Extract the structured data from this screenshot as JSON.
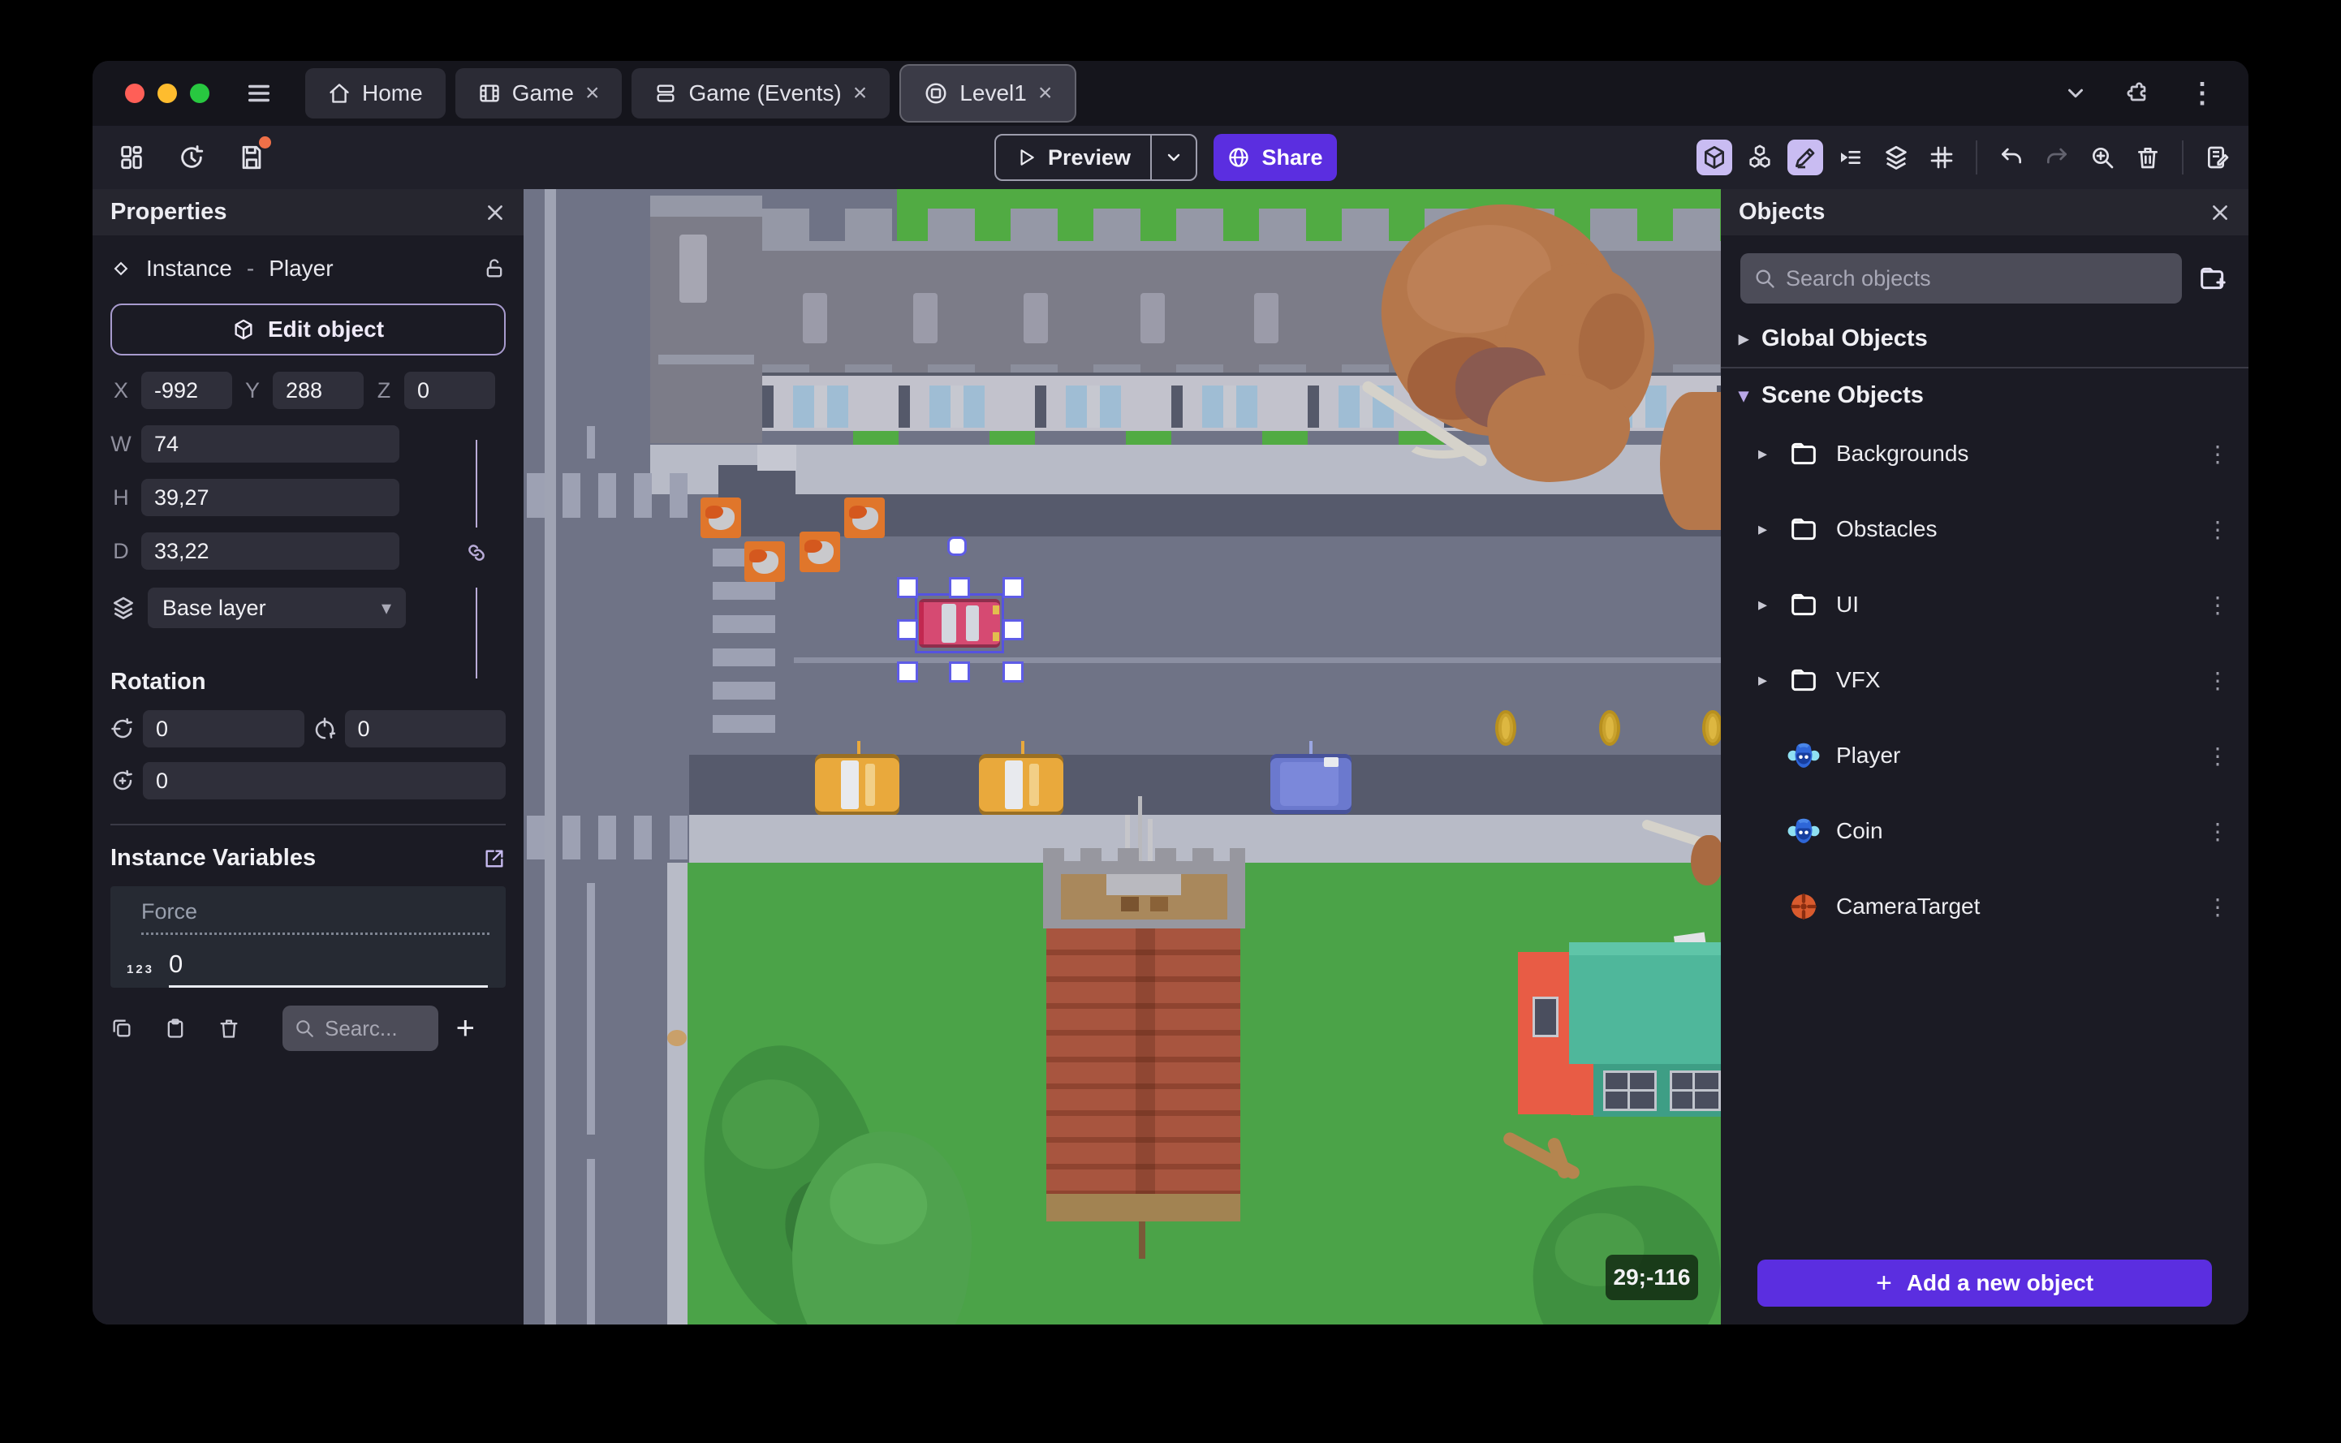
{
  "titlebar": {
    "tabs": [
      {
        "label": "Home",
        "icon": "home-icon",
        "closable": false
      },
      {
        "label": "Game",
        "icon": "film-icon",
        "closable": true
      },
      {
        "label": "Game (Events)",
        "icon": "events-icon",
        "closable": true
      },
      {
        "label": "Level1",
        "icon": "scene-icon",
        "closable": true,
        "active": true
      }
    ]
  },
  "toolbar": {
    "preview_label": "Preview",
    "share_label": "Share"
  },
  "properties": {
    "title": "Properties",
    "instance_label": "Instance",
    "separator": "-",
    "object_name": "Player",
    "edit_object_label": "Edit object",
    "position": {
      "x_label": "X",
      "x_value": "-992",
      "y_label": "Y",
      "y_value": "288",
      "z_label": "Z",
      "z_value": "0"
    },
    "size": {
      "w_label": "W",
      "w_value": "74",
      "h_label": "H",
      "h_value": "39,27",
      "d_label": "D",
      "d_value": "33,22"
    },
    "layer_value": "Base layer",
    "rotation": {
      "title": "Rotation",
      "x_value": "0",
      "y_value": "0",
      "z_value": "0"
    },
    "variables": {
      "title": "Instance Variables",
      "rows": [
        {
          "name": "Force",
          "type_badge": "123",
          "value": "0"
        }
      ],
      "search_placeholder": "Searc..."
    }
  },
  "objects": {
    "title": "Objects",
    "search_placeholder": "Search objects",
    "global_group_label": "Global Objects",
    "scene_group_label": "Scene Objects",
    "tree": [
      {
        "label": "Backgrounds",
        "kind": "folder"
      },
      {
        "label": "Obstacles",
        "kind": "folder"
      },
      {
        "label": "UI",
        "kind": "folder"
      },
      {
        "label": "VFX",
        "kind": "folder"
      },
      {
        "label": "Player",
        "kind": "3d-model"
      },
      {
        "label": "Coin",
        "kind": "3d-model"
      },
      {
        "label": "CameraTarget",
        "kind": "camera-target"
      }
    ],
    "add_button_label": "Add a new object"
  },
  "scene": {
    "cursor_coordinates": "29;-116"
  },
  "icons": {
    "close": "×",
    "plus": "+",
    "kebab": "⋮",
    "chevron_right": "▸",
    "chevron_down": "▾",
    "caret_down": "▾"
  },
  "colors": {
    "accent_purple": "#5B2EE0",
    "icon_highlight": "#C9BCF2",
    "panel_bg": "#1B1B24",
    "panel_header_bg": "#26262F",
    "input_bg": "#2F2F3A",
    "search_bg": "#4C4C58",
    "selection_blue": "#5E5CE6",
    "traffic_red": "#FF5F57",
    "traffic_yellow": "#FEBC2E",
    "traffic_green": "#28C840",
    "road": "#6F7386",
    "road_dark": "#565A6C",
    "sidewalk": "#B8BBC7",
    "crosswalk": "#9DA1B3",
    "grass": "#4BA348",
    "grass_top": "#51AB43",
    "brick": "#A8553F",
    "teal_roof": "#4FB79B",
    "building_orange": "#E85C45",
    "autumn_tree": "#B5774B",
    "coin_gold": "#DDB741",
    "car_pink": "#D64A72",
    "car_yellow": "#E9A93C",
    "car_blue": "#6B79CE",
    "obstacle_orange": "#E0762B"
  }
}
